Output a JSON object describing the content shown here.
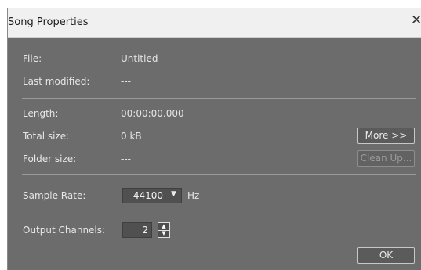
{
  "window": {
    "title": "Song Properties",
    "close_glyph": "✕"
  },
  "info": {
    "file_label": "File:",
    "file_value": "Untitled",
    "last_modified_label": "Last modified:",
    "last_modified_value": "---",
    "length_label": "Length:",
    "length_value": "00:00:00.000",
    "total_size_label": "Total size:",
    "total_size_value": "0 kB",
    "folder_size_label": "Folder size:",
    "folder_size_value": "---"
  },
  "buttons": {
    "more_label": "More >>",
    "cleanup_label": "Clean Up...",
    "ok_label": "OK"
  },
  "settings": {
    "sample_rate_label": "Sample Rate:",
    "sample_rate_value": "44100",
    "sample_rate_unit": "Hz",
    "output_channels_label": "Output Channels:",
    "output_channels_value": "2"
  },
  "colors": {
    "dialog_bg": "#6c6c6c",
    "titlebar_bg": "#f0f0f0",
    "text": "#e6e6e6"
  }
}
